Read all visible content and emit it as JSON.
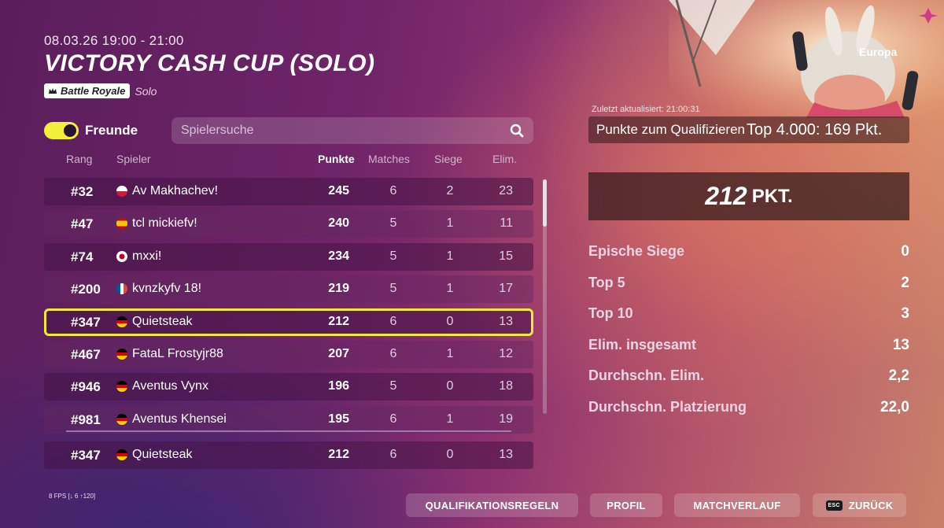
{
  "header": {
    "date": "08.03.26 19:00 - 21:00",
    "title": "VICTORY CASH CUP (SOLO)",
    "mode_label": "Battle Royale",
    "mode_sub": "Solo"
  },
  "controls": {
    "friends_label": "Freunde",
    "friends_toggle_on": true,
    "search_placeholder": "Spielersuche"
  },
  "table": {
    "columns": [
      "Rang",
      "Spieler",
      "Punkte",
      "Matches",
      "Siege",
      "Elim."
    ],
    "rows": [
      {
        "rank": "#32",
        "flag": "pl",
        "name": "Av Makhachev!",
        "points": "245",
        "matches": "6",
        "wins": "2",
        "elims": "23"
      },
      {
        "rank": "#47",
        "flag": "es",
        "name": "tcl mickiefv!",
        "points": "240",
        "matches": "5",
        "wins": "1",
        "elims": "11"
      },
      {
        "rank": "#74",
        "flag": "jp",
        "name": "mxxi!",
        "points": "234",
        "matches": "5",
        "wins": "1",
        "elims": "15"
      },
      {
        "rank": "#200",
        "flag": "fr",
        "name": "kvnzkyfv 18!",
        "points": "219",
        "matches": "5",
        "wins": "1",
        "elims": "17"
      },
      {
        "rank": "#347",
        "flag": "de",
        "name": "Quietsteak",
        "points": "212",
        "matches": "6",
        "wins": "0",
        "elims": "13"
      },
      {
        "rank": "#467",
        "flag": "de",
        "name": "FataL Frostyjr88",
        "points": "207",
        "matches": "6",
        "wins": "1",
        "elims": "12"
      },
      {
        "rank": "#946",
        "flag": "de",
        "name": "Aventus Vynx",
        "points": "196",
        "matches": "5",
        "wins": "0",
        "elims": "18"
      },
      {
        "rank": "#981",
        "flag": "de",
        "name": "Aventus Khensei",
        "points": "195",
        "matches": "6",
        "wins": "1",
        "elims": "19"
      }
    ],
    "own_row": {
      "rank": "#347",
      "flag": "de",
      "name": "Quietsteak",
      "points": "212",
      "matches": "6",
      "wins": "0",
      "elims": "13"
    }
  },
  "panel": {
    "region": "Europa",
    "updated": "Zuletzt aktualisiert: 21:00:31",
    "qualify_label": "Punkte zum Qualifizieren",
    "qualify_value": "Top 4.000: 169 Pkt.",
    "points_value": "212",
    "points_unit": "PKT.",
    "stats": [
      {
        "label": "Epische Siege",
        "value": "0"
      },
      {
        "label": "Top 5",
        "value": "2"
      },
      {
        "label": "Top 10",
        "value": "3"
      },
      {
        "label": "Elim. insgesamt",
        "value": "13"
      },
      {
        "label": "Durchschn. Elim.",
        "value": "2,2"
      },
      {
        "label": "Durchschn. Platzierung",
        "value": "22,0"
      }
    ]
  },
  "footer": {
    "fps": "8 FPS [↓ 6 ↑120]",
    "btn_rules": "QUALIFIKATIONSREGELN",
    "btn_profile": "PROFIL",
    "btn_history": "MATCHVERLAUF",
    "esc_key": "ESC",
    "btn_back": "ZURÜCK"
  },
  "colors": {
    "highlight": "#f2e93a",
    "toggle": "#f4ef3a"
  }
}
